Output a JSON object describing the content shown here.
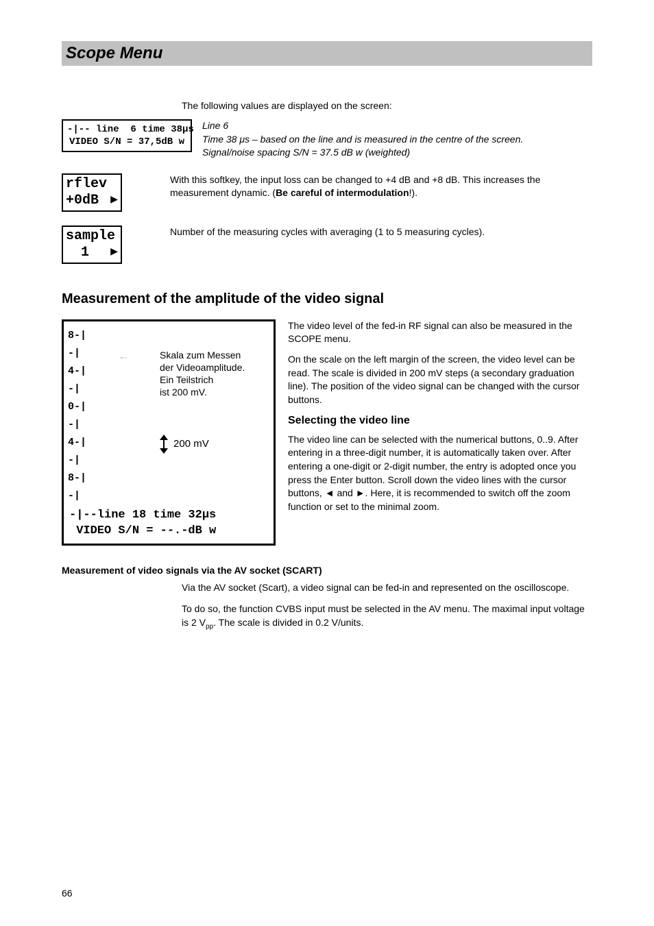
{
  "header": {
    "title": "Scope Menu"
  },
  "intro": "The following values are displayed on the screen:",
  "display_box": "-|-- line  6 time 38μs\nVIDEO S/N = 37,5dB w",
  "display_caption": {
    "line1": "Line 6",
    "line2": "Time 38 μs – based on the line and is measured in the centre of the screen.",
    "line3": "Signal/noise spacing S/N = 37.5 dB w (weighted)"
  },
  "softkeys": {
    "rflev": {
      "label1": "rflev",
      "label2": "+0dB",
      "desc": "With this softkey, the input loss can be changed to +4 dB and +8 dB. This increases the measurement dynamic. (",
      "bold": "Be careful of intermodulation",
      "tail": "!)."
    },
    "sample": {
      "label1": "sample",
      "label2": "1",
      "desc": "Number of the measuring cycles with averaging (1 to 5 measuring cycles)."
    }
  },
  "section1": {
    "heading": "Measurement of the amplitude of the video signal",
    "scope": {
      "scale_labels": [
        "8-|",
        " -|",
        "4-|",
        " -|",
        "0-|",
        " -|",
        "4-|",
        " -|",
        "8-|",
        " -|"
      ],
      "annot": "Skala zum Messen\nder Videoamplitude.\nEin Teilstrich\nist 200 mV.",
      "mv_label": "200 mV",
      "bottom": "-|--line 18 time 32μs\n VIDEO S/N = --.-dB w"
    },
    "paras": {
      "p1": "The video level of the fed-in RF signal can also be measured in the SCOPE menu.",
      "p2": "On the scale on the left margin of the screen, the video level can be read. The scale is divided in 200 mV steps (a secondary graduation line). The position of the video signal can be changed with the cursor buttons.",
      "h3": "Selecting the video line",
      "p3": "The video line can be selected with the numerical buttons, 0..9.  After entering in a three-digit number, it is automatically taken over. After entering a one-digit or 2-digit number, the entry is adopted once you press the Enter button. Scroll down the video lines with the cursor buttons, ◄ and ►. Here, it is recommended to switch off the zoom function or set to the minimal zoom."
    }
  },
  "section2": {
    "heading": "Measurement of video signals via the AV socket (SCART)",
    "p1": "Via the AV socket (Scart), a video signal can be fed-in and represented on the oscilloscope.",
    "p2a": "To do so, the function CVBS input must be selected in the AV menu. The maximal input voltage is  2 V",
    "p2sub": "pp",
    "p2b": ". The scale is divided in 0.2 V/units."
  },
  "page_number": "66"
}
